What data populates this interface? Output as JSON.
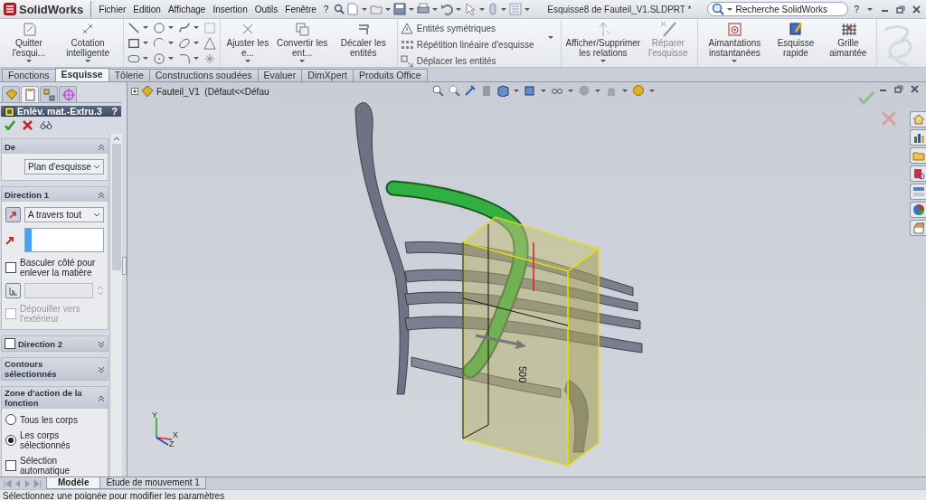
{
  "app": {
    "logo": "SolidWorks"
  },
  "menu": [
    {
      "label": "Fichier"
    },
    {
      "label": "Edition"
    },
    {
      "label": "Affichage"
    },
    {
      "label": "Insertion"
    },
    {
      "label": "Outils"
    },
    {
      "label": "Fenêtre"
    },
    {
      "label": "?"
    }
  ],
  "window": {
    "title": "Esquisse8 de Fauteil_V1.SLDPRT *",
    "help": "?"
  },
  "search": {
    "placeholder": "Recherche SolidWorks"
  },
  "command_groups": [
    {
      "kind": "large",
      "items": [
        {
          "label": "Quitter l'esqui...",
          "dropdown": true,
          "disabled": false
        },
        {
          "label": "Cotation intelligente",
          "dropdown": true,
          "disabled": false
        }
      ]
    },
    {
      "kind": "large",
      "items": [
        {
          "label": "Ajuster les e...",
          "dropdown": true,
          "disabled": false
        },
        {
          "label": "Convertir les ent...",
          "dropdown": true,
          "disabled": false
        },
        {
          "label": "Décaler les entités",
          "dropdown": false,
          "disabled": false
        }
      ]
    },
    {
      "kind": "list",
      "items": [
        {
          "label": "Entités symétriques"
        },
        {
          "label": "Répétition linéaire d'esquisse"
        },
        {
          "label": "Déplacer les entités"
        }
      ]
    },
    {
      "kind": "large",
      "items": [
        {
          "label": "Afficher/Supprimer les relations",
          "dropdown": true,
          "disabled": false
        },
        {
          "label": "Réparer l'esquisse",
          "dropdown": false,
          "disabled": true
        }
      ]
    },
    {
      "kind": "large",
      "items": [
        {
          "label": "Aimantations instantanées",
          "dropdown": true,
          "disabled": false
        },
        {
          "label": "Esquisse rapide",
          "dropdown": false,
          "disabled": false
        },
        {
          "label": "Grille aimantée",
          "dropdown": false,
          "disabled": false
        }
      ]
    }
  ],
  "tabs": [
    {
      "label": "Fonctions",
      "selected": false
    },
    {
      "label": "Esquisse",
      "selected": true
    },
    {
      "label": "Tôlerie",
      "selected": false
    },
    {
      "label": "Constructions soudées",
      "selected": false
    },
    {
      "label": "Evaluer",
      "selected": false
    },
    {
      "label": "DimXpert",
      "selected": false
    },
    {
      "label": "Produits Office",
      "selected": false
    }
  ],
  "property_manager": {
    "tabs": [
      {
        "selected": false
      },
      {
        "selected": true
      },
      {
        "selected": false
      },
      {
        "selected": false
      }
    ],
    "title": "Enlèv. mat.-Extru.3",
    "help": "?",
    "sections": [
      {
        "title": "De",
        "expanded": true,
        "controls": [
          {
            "kind": "dropdown",
            "value": "Plan d'esquisse",
            "reverse_button": false
          }
        ]
      },
      {
        "title": "Direction 1",
        "expanded": true,
        "controls": [
          {
            "kind": "dropdown",
            "value": "A travers tout",
            "reverse_button": true
          },
          {
            "kind": "selection"
          },
          {
            "kind": "checkbox",
            "label": "Basculer côté pour enlever la matière",
            "checked": false,
            "disabled": false
          },
          {
            "kind": "angle"
          },
          {
            "kind": "checkbox",
            "label": "Dépouiller vers l'extérieur",
            "checked": false,
            "disabled": true
          }
        ]
      },
      {
        "title": "Direction 2",
        "expanded": false,
        "checkbox": {
          "checked": false
        }
      },
      {
        "title": "Contours sélectionnés",
        "expanded": false
      },
      {
        "title": "Zone d'action de la fonction",
        "expanded": true,
        "controls": [
          {
            "kind": "radio",
            "label": "Tous les corps",
            "selected": false
          },
          {
            "kind": "radio",
            "label": "Les corps sélectionnés",
            "selected": true
          },
          {
            "kind": "checkbox",
            "label": "Sélection automatique",
            "checked": false,
            "disabled": false
          }
        ]
      }
    ]
  },
  "viewport": {
    "tree_item": "Fauteil_V1  (Défaut<<Défau",
    "dimension": "500",
    "axes": [
      {
        "label": "Y"
      },
      {
        "label": "X"
      },
      {
        "label": "Z"
      }
    ]
  },
  "bottom_tabs": [
    {
      "label": "Modèle",
      "selected": true
    },
    {
      "label": "Etude de mouvement 1",
      "selected": false
    }
  ],
  "status": "Sélectionnez une poignée pour modifier les paramètres"
}
